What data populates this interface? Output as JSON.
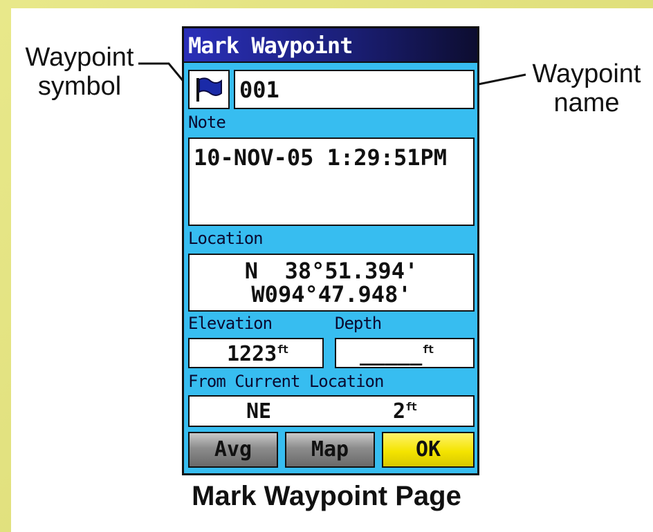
{
  "window": {
    "title": "Mark Waypoint"
  },
  "waypoint": {
    "symbol_icon": "blue-flag-icon",
    "name": "001",
    "note_label": "Note",
    "note": "10-NOV-05 1:29:51PM",
    "location_label": "Location",
    "location_lat": "N  38°51.394'",
    "location_lon": "W094°47.948'",
    "elevation_label": "Elevation",
    "elevation": "1223",
    "elevation_unit": "ft",
    "depth_label": "Depth",
    "depth": "_____",
    "depth_unit": "ft",
    "from_label": "From Current Location",
    "bearing": "NE",
    "distance": "2",
    "distance_unit": "ft"
  },
  "buttons": {
    "avg": "Avg",
    "map": "Map",
    "ok": "OK"
  },
  "callouts": {
    "symbol_line1": "Waypoint",
    "symbol_line2": "symbol",
    "name_line1": "Waypoint",
    "name_line2": "name"
  },
  "caption": "Mark Waypoint Page",
  "colors": {
    "screen_bg": "#37bdf0",
    "title_bg": "#1b1f78",
    "ok_button": "#f4e400",
    "flag": "#1a2aa8"
  }
}
